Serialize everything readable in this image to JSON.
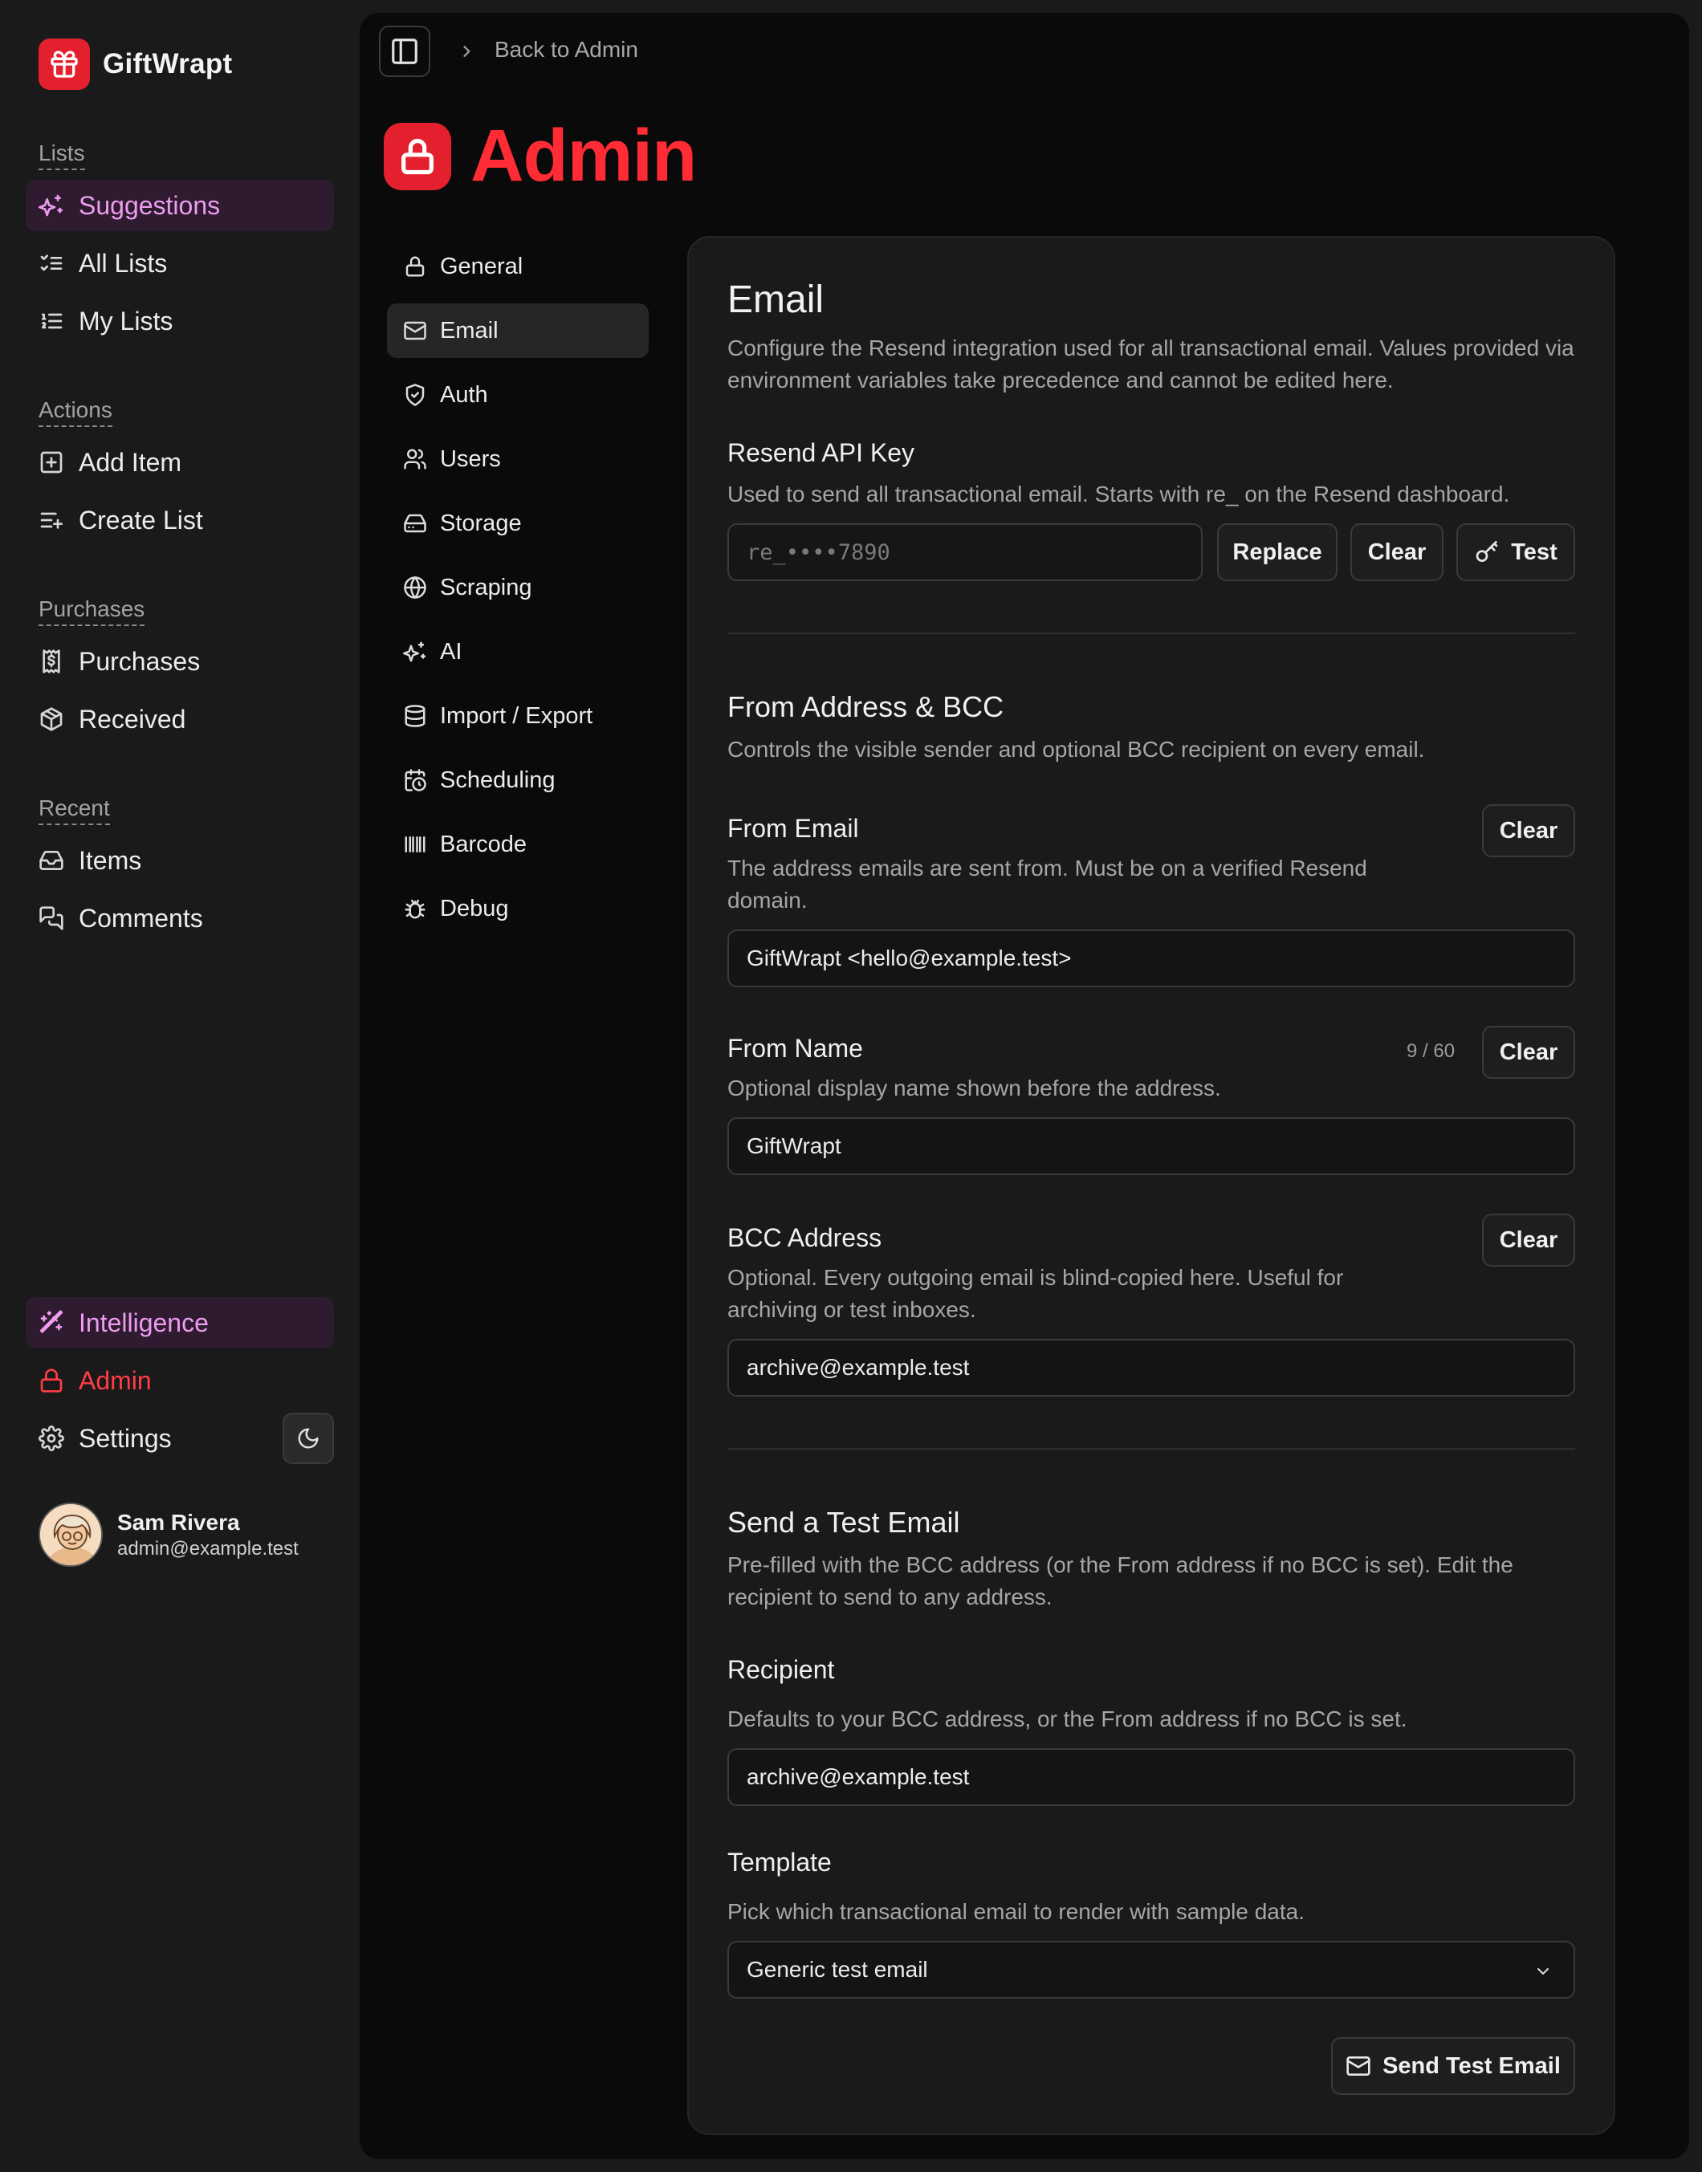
{
  "brand": {
    "name": "GiftWrapt",
    "logo_icon": "gift-icon",
    "accent": "#e5202e"
  },
  "sidebar": {
    "groups": {
      "lists": "Lists",
      "actions": "Actions",
      "purchases": "Purchases",
      "recent": "Recent"
    },
    "items": {
      "suggestions": "Suggestions",
      "all_lists": "All Lists",
      "my_lists": "My Lists",
      "add_item": "Add Item",
      "create_list": "Create List",
      "purchases": "Purchases",
      "received": "Received",
      "items": "Items",
      "comments": "Comments",
      "intelligence": "Intelligence",
      "admin": "Admin",
      "settings": "Settings"
    },
    "user": {
      "name": "Sam Rivera",
      "email": "admin@example.test"
    }
  },
  "header": {
    "breadcrumb": "Back to Admin",
    "title": "Admin"
  },
  "admin_nav": {
    "general": "General",
    "email": "Email",
    "auth": "Auth",
    "users": "Users",
    "storage": "Storage",
    "scraping": "Scraping",
    "ai": "AI",
    "import_export": "Import / Export",
    "scheduling": "Scheduling",
    "barcode": "Barcode",
    "debug": "Debug"
  },
  "email_card": {
    "title": "Email",
    "description": "Configure the Resend integration used for all transactional email. Values provided via environment variables take precedence and cannot be edited here.",
    "api_key": {
      "label": "Resend API Key",
      "description": "Used to send all transactional email. Starts with re_ on the Resend dashboard.",
      "placeholder": "re_••••7890",
      "replace": "Replace",
      "clear": "Clear",
      "test": "Test"
    },
    "from_section": {
      "title": "From Address & BCC",
      "description": "Controls the visible sender and optional BCC recipient on every email."
    },
    "from_email": {
      "label": "From Email",
      "description": "The address emails are sent from. Must be on a verified Resend domain.",
      "value": "GiftWrapt <hello@example.test>",
      "clear": "Clear"
    },
    "from_name": {
      "label": "From Name",
      "description": "Optional display name shown before the address.",
      "value": "GiftWrapt",
      "counter": "9 / 60",
      "clear": "Clear"
    },
    "bcc": {
      "label": "BCC Address",
      "description": "Optional. Every outgoing email is blind-copied here. Useful for archiving or test inboxes.",
      "value": "archive@example.test",
      "clear": "Clear"
    },
    "test_section": {
      "title": "Send a Test Email",
      "description": "Pre-filled with the BCC address (or the From address if no BCC is set). Edit the recipient to send to any address."
    },
    "recipient": {
      "label": "Recipient",
      "description": "Defaults to your BCC address, or the From address if no BCC is set.",
      "value": "archive@example.test"
    },
    "template": {
      "label": "Template",
      "description": "Pick which transactional email to render with sample data.",
      "selected": "Generic test email"
    },
    "send_button": "Send Test Email"
  }
}
